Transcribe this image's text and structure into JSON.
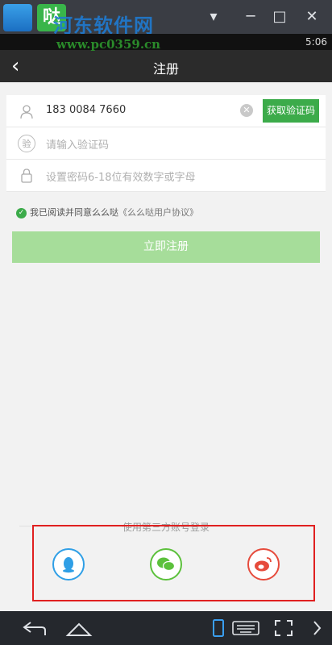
{
  "emulator": {
    "app_icon_text": "哒",
    "watermark": "河东软件网",
    "watermark_url": "www.pc0359.cn",
    "controls": [
      "▾",
      "─",
      "□",
      "✕"
    ]
  },
  "status_bar": {
    "time": "5:06"
  },
  "header": {
    "back_icon": "‹",
    "title": "注册"
  },
  "form": {
    "phone": {
      "value": "183 0084 7660",
      "clear_icon": "✕"
    },
    "get_code_label": "获取验证码",
    "code_icon_label": "验",
    "code_placeholder": "请输入验证码",
    "password_placeholder": "设置密码6-18位有效数字或字母"
  },
  "agreement": {
    "text": "我已阅读并同意么么哒",
    "link": "《么么哒用户协议》"
  },
  "register_label": "立即注册",
  "third_party": {
    "title": "使用第三方账号登录",
    "providers": [
      {
        "name": "qq-icon",
        "color": "#2f9fe6"
      },
      {
        "name": "wechat-icon",
        "color": "#5cc13c"
      },
      {
        "name": "weibo-icon",
        "color": "#e64b3c"
      }
    ]
  },
  "colors": {
    "accent_green": "#3cab4a",
    "button_disabled_green": "#a6dd9a",
    "highlight_red": "#e02020"
  }
}
